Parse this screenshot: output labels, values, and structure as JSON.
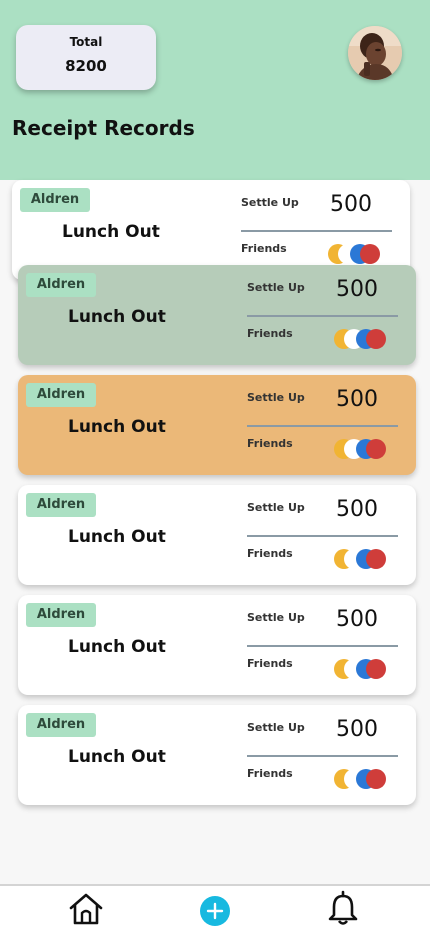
{
  "header": {
    "total_label": "Total",
    "total_value": "8200",
    "title": "Receipt Records",
    "avatar_icon": "user-avatar"
  },
  "records": [
    {
      "tag": "Aldren",
      "title": "Lunch Out",
      "settle_label": "Settle Up",
      "amount": "500",
      "friends_label": "Friends",
      "color": "#ffffff"
    },
    {
      "tag": "Aldren",
      "title": "Lunch Out",
      "settle_label": "Settle Up",
      "amount": "500",
      "friends_label": "Friends",
      "color": "#b6ccb9"
    },
    {
      "tag": "Aldren",
      "title": "Lunch Out",
      "settle_label": "Settle Up",
      "amount": "500",
      "friends_label": "Friends",
      "color": "#ebb878"
    },
    {
      "tag": "Aldren",
      "title": "Lunch Out",
      "settle_label": "Settle Up",
      "amount": "500",
      "friends_label": "Friends",
      "color": "#ffffff"
    },
    {
      "tag": "Aldren",
      "title": "Lunch Out",
      "settle_label": "Settle Up",
      "amount": "500",
      "friends_label": "Friends",
      "color": "#ffffff"
    },
    {
      "tag": "Aldren",
      "title": "Lunch Out",
      "settle_label": "Settle Up",
      "amount": "500",
      "friends_label": "Friends",
      "color": "#ffffff"
    }
  ],
  "friend_colors": [
    "#f1b433",
    "#ffffff",
    "#2b78d6",
    "#cf3d3a"
  ],
  "tabbar": {
    "home_icon": "home-icon",
    "add_icon": "add-icon",
    "bell_icon": "bell-icon"
  },
  "colors": {
    "header_bg": "#abe0c3",
    "tag_bg": "#abe0c3",
    "accent_add": "#17b9e0"
  }
}
